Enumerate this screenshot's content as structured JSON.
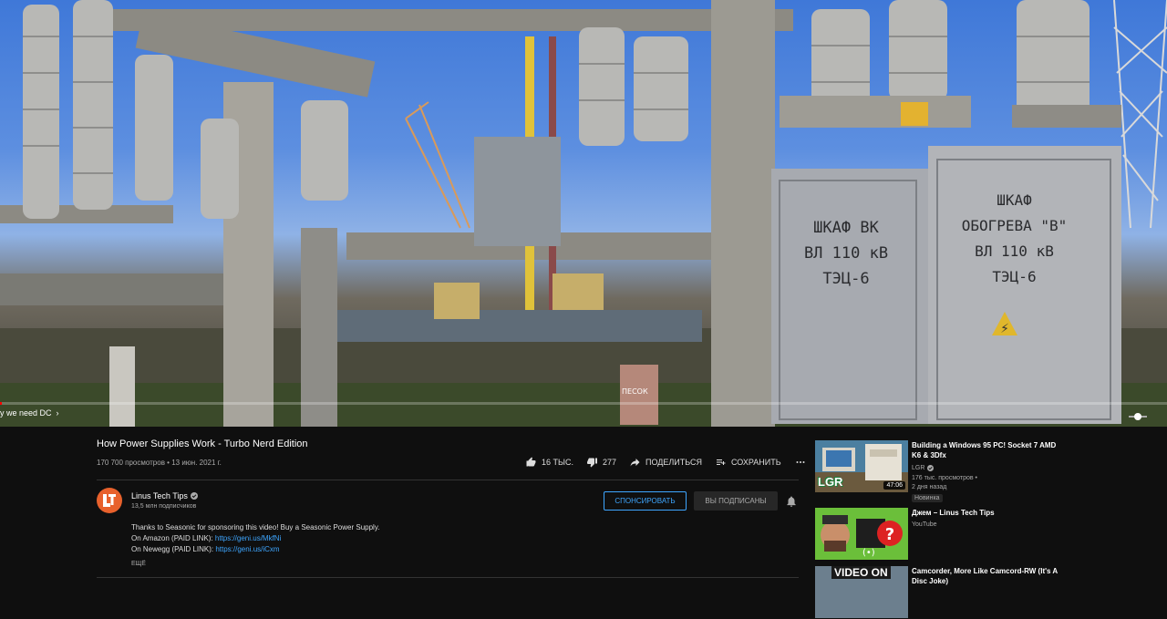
{
  "player": {
    "chapter_label": "y we need DC",
    "progress_fraction": 0.0,
    "signs": {
      "left": [
        "ШКАФ ВК",
        "ВЛ 110 кВ",
        "ТЭЦ-6"
      ],
      "right": [
        "ШКАФ",
        "ОБОГРЕВА \"В\"",
        "ВЛ 110 кВ",
        "ТЭЦ-6"
      ],
      "barrel": "ПЕСОК"
    }
  },
  "video": {
    "title": "How Power Supplies Work - Turbo Nerd Edition",
    "meta": "170 700 просмотров • 13 июн. 2021 г.",
    "likes": "16 ТЫС.",
    "dislikes": "277",
    "share_label": "ПОДЕЛИТЬСЯ",
    "save_label": "СОХРАНИТЬ",
    "more_icon": "more-horizontal-icon"
  },
  "channel": {
    "name": "Linus Tech Tips",
    "subscribers": "13,5 млн подписчиков",
    "sponsor_label": "СПОНСИРОВАТЬ",
    "subscribed_label": "ВЫ ПОДПИСАНЫ"
  },
  "description": {
    "line1": "Thanks to Seasonic for sponsoring this video! Buy a Seasonic Power Supply.",
    "line2_prefix": "On Amazon (PAID LINK): ",
    "line2_link": "https://geni.us/MkfNi",
    "line3_prefix": "On Newegg (PAID LINK): ",
    "line3_link": "https://geni.us/iCxm",
    "more_label": "ЕЩЁ"
  },
  "sidebar": {
    "items": [
      {
        "title": "Building a Windows 95 PC! Socket 7 AMD K6 & 3Dfx",
        "channel": "LGR",
        "views": "176 тыс. просмотров •",
        "age": "2 дня назад",
        "badge": "Новинка",
        "duration": "47:06",
        "thumb_text": "LGR"
      },
      {
        "title": "Джем – Linus Tech Tips",
        "channel": "YouTube"
      },
      {
        "title": "Camcorder, More Like Camcord-RW (It's A Disc Joke)",
        "thumb_text": "VIDEO ON"
      }
    ]
  },
  "colors": {
    "background": "#0f0f0f",
    "accent_blue": "#3ea6ff",
    "channel_orange": "#e8612c"
  }
}
